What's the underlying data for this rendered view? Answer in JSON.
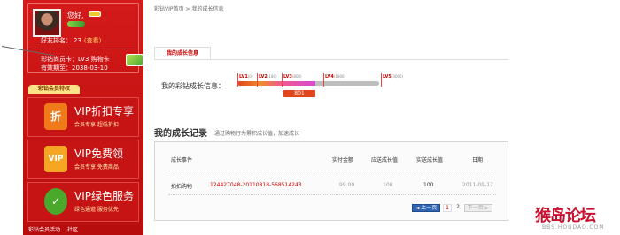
{
  "sidebar": {
    "greeting": "您好,",
    "friend_rank_label": "好友排名：",
    "friend_rank_value": "23",
    "view_link": "(查看)",
    "member_card": "彩钻尚员卡：LV3 购物卡",
    "expiry": "有效期至：2038-03-10",
    "privilege_tab": "彩钻会员特权",
    "promos": [
      {
        "title": "VIP折扣专享",
        "sub": "会员专享 超低折扣",
        "icon": "折"
      },
      {
        "title": "VIP免费领",
        "sub": "会员专享 免费商品",
        "icon": "VIP"
      },
      {
        "title": "VIP绿色服务",
        "sub": "绿色通道 服务优先",
        "icon": "✓"
      }
    ],
    "footer": [
      "彩钻会员活动",
      "社区"
    ]
  },
  "breadcrumb": {
    "home": "彩钻VIP首页",
    "sep": ">",
    "current": "我的成长信息"
  },
  "tab": {
    "label": "我的成长信息"
  },
  "growth": {
    "label": "我的彩钻成长信息：",
    "current_value": "801",
    "progress_fraction": 0.55,
    "levels": [
      {
        "name": "LV1",
        "value": "(0)"
      },
      {
        "name": "LV2",
        "value": "(180)"
      },
      {
        "name": "LV3",
        "value": "(800)"
      },
      {
        "name": "LV4",
        "value": "(1800)"
      },
      {
        "name": "LV5",
        "value": "(3000)"
      }
    ]
  },
  "records": {
    "title": "我的成长记录",
    "hint": "通过购物行为累积成长值，加速成长",
    "headers": [
      "成长事件",
      "实付金额",
      "应送成长值",
      "实送成长值",
      "日期"
    ],
    "rows": [
      {
        "event": "拍拍购物",
        "order": "124427048-20110818-568514243",
        "paid": "99.00",
        "due": "100",
        "given": "100",
        "date": "2011-09-17"
      }
    ]
  },
  "pagination": {
    "prev": "◄ 上一页",
    "page1": "1",
    "page2": "2",
    "next": "下一页 ►"
  },
  "watermark": {
    "title": "猴岛论坛",
    "url": "BBS.HOUDAO.COM"
  },
  "colors": {
    "sidebar_red": "#c61414",
    "accent_red": "#cc0000",
    "pager_blue": "#2f64b3"
  }
}
